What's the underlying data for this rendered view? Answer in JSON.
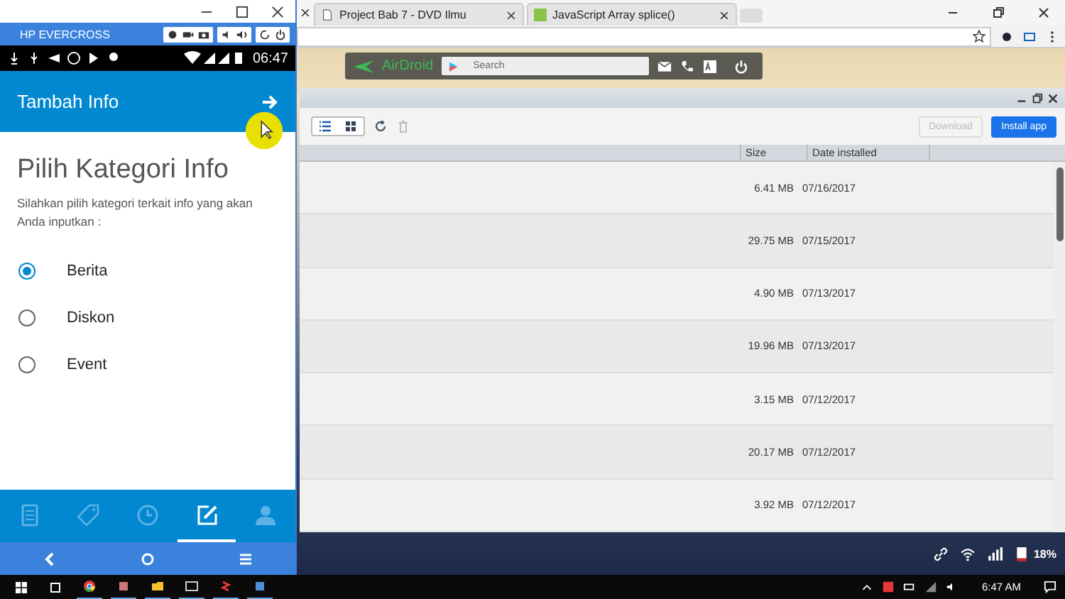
{
  "phone": {
    "device_name": "HP EVERCROSS",
    "status_time": "06:47",
    "app_bar": {
      "title": "Tambah Info"
    },
    "heading": "Pilih Kategori Info",
    "description": "Silahkan pilih kategori terkait info yang akan Anda inputkan :",
    "options": [
      {
        "label": "Berita",
        "selected": true
      },
      {
        "label": "Diskon",
        "selected": false
      },
      {
        "label": "Event",
        "selected": false
      }
    ],
    "bottom_nav": [
      {
        "kind": "document",
        "selected": false
      },
      {
        "kind": "tag",
        "selected": false
      },
      {
        "kind": "clock",
        "selected": false
      },
      {
        "kind": "edit",
        "selected": true
      },
      {
        "kind": "person",
        "selected": false
      }
    ]
  },
  "browser": {
    "tabs": [
      {
        "title": "Project Bab 7 - DVD Ilmu"
      },
      {
        "title": "JavaScript Array splice()"
      }
    ],
    "airdroid": {
      "logo": "AirDroid",
      "search": {
        "placeholder": "Search"
      }
    },
    "app_window": {
      "buttons": [
        {
          "label": "Download",
          "disabled": true
        },
        {
          "label": "Install app",
          "disabled": false
        }
      ],
      "columns": [
        "Size",
        "Date installed"
      ],
      "rows": [
        {
          "size": "6.41 MB",
          "date": "07/16/2017"
        },
        {
          "size": "29.75 MB",
          "date": "07/15/2017"
        },
        {
          "size": "4.90 MB",
          "date": "07/13/2017"
        },
        {
          "size": "19.96 MB",
          "date": "07/13/2017"
        },
        {
          "size": "3.15 MB",
          "date": "07/12/2017"
        },
        {
          "size": "20.17 MB",
          "date": "07/12/2017"
        },
        {
          "size": "3.92 MB",
          "date": "07/12/2017"
        }
      ]
    },
    "phone_battery": "18%"
  },
  "taskbar": {
    "time": "6:47 AM"
  }
}
